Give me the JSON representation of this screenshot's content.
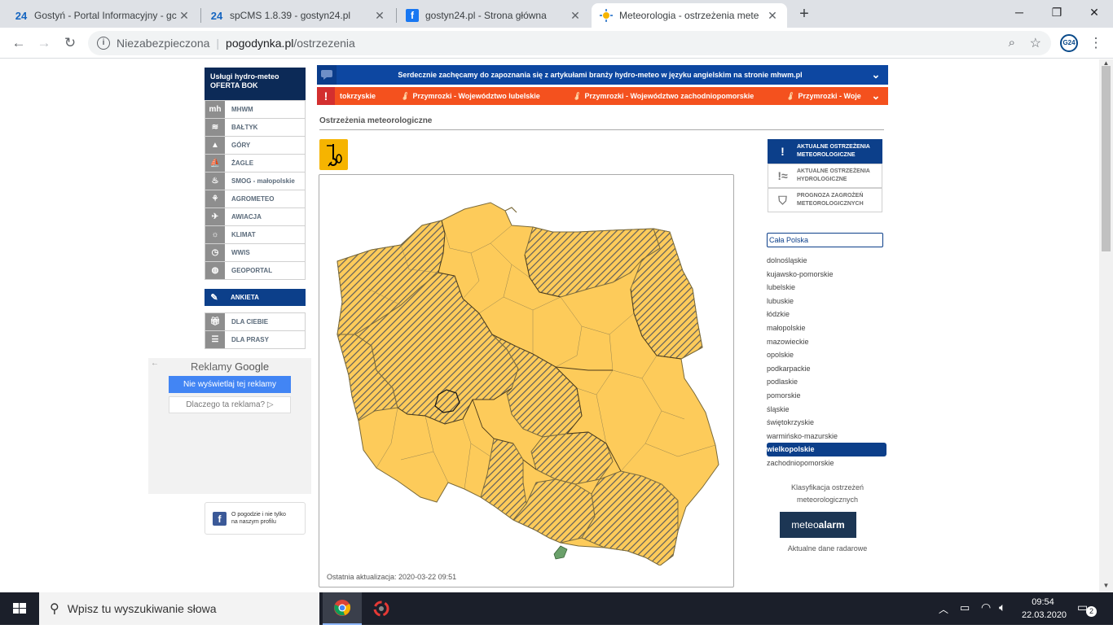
{
  "browser": {
    "tabs": [
      {
        "favicon": "24",
        "title": "Gostyń - Portal Informacyjny - gc"
      },
      {
        "favicon": "24",
        "title": "spCMS 1.8.39 - gostyn24.pl"
      },
      {
        "favicon": "f",
        "title": "gostyn24.pl - Strona główna"
      },
      {
        "favicon": "sun",
        "title": "Meteorologia - ostrzeżenia mete"
      }
    ],
    "new_tab": "+",
    "url_insecure": "Niezabezpieczona",
    "url_domain": "pogodynka.pl",
    "url_path": "/ostrzezenia",
    "extension_label": "G24"
  },
  "left_menu": {
    "header_line1": "Usługi hydro-meteo",
    "header_line2": "OFERTA BOK",
    "items": [
      {
        "label": "MHWM",
        "icon": "mhwm-icon"
      },
      {
        "label": "BAŁTYK",
        "icon": "waves-icon"
      },
      {
        "label": "GÓRY",
        "icon": "mountains-icon"
      },
      {
        "label": "ŻAGLE",
        "icon": "sail-icon"
      },
      {
        "label": "SMOG - małopolskie",
        "icon": "smog-icon"
      },
      {
        "label": "AGROMETEO",
        "icon": "wheat-icon"
      },
      {
        "label": "AWIACJA",
        "icon": "plane-icon"
      },
      {
        "label": "KLIMAT",
        "icon": "sun-icon"
      },
      {
        "label": "WWIS",
        "icon": "clock-icon"
      },
      {
        "label": "GEOPORTAL",
        "icon": "globe-icon"
      }
    ],
    "ankieta": "ANKIETA",
    "extra": [
      {
        "label": "DLA CIEBIE",
        "icon": "gift-icon"
      },
      {
        "label": "DLA PRASY",
        "icon": "press-icon"
      }
    ]
  },
  "ads": {
    "title_prefix": "Reklamy",
    "title_brand": "Google",
    "hide_button": "Nie wyświetlaj tej reklamy",
    "why_button": "Dlaczego ta reklama? ▷"
  },
  "facebook": {
    "line1": "O pogodzie i nie tylko",
    "line2": "na naszym profilu"
  },
  "banners": {
    "info": "Serdecznie zachęcamy do zapoznania się z artykułami branży hydro-meteo w języku angielskim na stronie mhwm.pl",
    "warnings": [
      "tokrzyskie",
      "Przymrozki - Województwo lubelskie",
      "Przymrozki - Województwo zachodniopomorskie",
      "Przymrozki - Woje"
    ]
  },
  "section_title": "Ostrzeżenia meteorologiczne",
  "map": {
    "last_update": "Ostatnia aktualizacja: 2020-03-22 09:51",
    "colors": {
      "warning_fill": "#fdcb5a",
      "border": "#7a6a3a",
      "hatch": "#5d5d5d",
      "green_zone": "#6aa06a"
    }
  },
  "right_panel": {
    "tabs": [
      {
        "line1": "AKTUALNE OSTRZEŻENIA",
        "line2": "METEOROLOGICZNE",
        "icon": "!"
      },
      {
        "line1": "AKTUALNE OSTRZEŻENIA",
        "line2": "HYDROLOGICZNE",
        "icon": "!≈"
      },
      {
        "line1": "PROGNOZA ZAGROŻEŃ",
        "line2": "METEOROLOGICZNYCH",
        "icon": "⛉"
      }
    ],
    "select_value": "Cała Polska",
    "regions": [
      "dolnośląskie",
      "kujawsko-pomorskie",
      "lubelskie",
      "lubuskie",
      "łódzkie",
      "małopolskie",
      "mazowieckie",
      "opolskie",
      "podkarpackie",
      "podlaskie",
      "pomorskie",
      "śląskie",
      "świętokrzyskie",
      "warmińsko-mazurskie",
      "wielkopolskie",
      "zachodniopomorskie"
    ],
    "active_region": "wielkopolskie",
    "classification_line1": "Klasyfikacja ostrzeżeń",
    "classification_line2": "meteorologicznych",
    "meteoalarm_a": "meteo",
    "meteoalarm_b": "alarm",
    "radar": "Aktualne dane radarowe"
  },
  "taskbar": {
    "search_placeholder": "Wpisz tu wyszukiwanie słowa",
    "time": "09:54",
    "date": "22.03.2020",
    "notifications": "2"
  }
}
